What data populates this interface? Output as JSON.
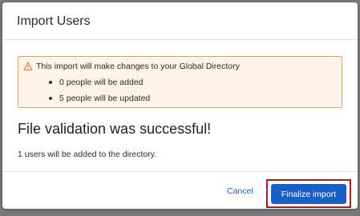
{
  "modal": {
    "title": "Import Users"
  },
  "warning": {
    "icon": "warning-triangle-icon",
    "message": "This import will make changes to your Global Directory",
    "bullets": [
      "0 people will be added",
      "5 people will be updated"
    ]
  },
  "result": {
    "title": "File validation was successful!",
    "info": "1 users will be added to the directory."
  },
  "footer": {
    "cancel_label": "Cancel",
    "finalize_label": "Finalize import"
  },
  "colors": {
    "accent": "#1a5fc7",
    "warning_border": "#e8a15b",
    "warning_bg": "#fdf3e8",
    "highlight": "#a02020"
  }
}
